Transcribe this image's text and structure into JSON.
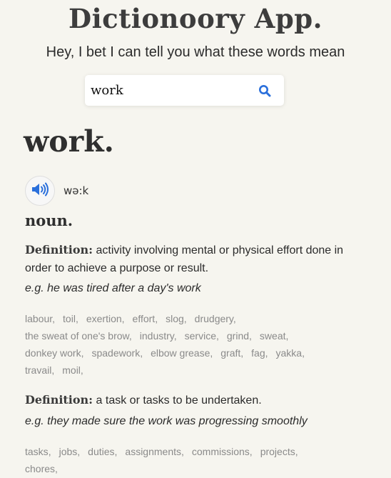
{
  "header": {
    "title": "Dictionoory App.",
    "subtitle": "Hey, I bet I can tell you what these words mean"
  },
  "search": {
    "value": "work",
    "icon": "search-icon"
  },
  "entry": {
    "word": "work.",
    "phonetic": "wə:k",
    "audio_icon": "speaker-icon",
    "part_of_speech": "noun.",
    "definitions": [
      {
        "label": "Definition:",
        "text": "activity involving mental or physical effort done in order to achieve a purpose or result.",
        "example": "e.g. he was tired after a day's work",
        "synonyms": [
          "labour",
          "toil",
          "exertion",
          "effort",
          "slog",
          "drudgery",
          "the sweat of one's brow",
          "industry",
          "service",
          "grind",
          "sweat",
          "donkey work",
          "spadework",
          "elbow grease",
          "graft",
          "fag",
          "yakka",
          "travail",
          "moil"
        ]
      },
      {
        "label": "Definition:",
        "text": "a task or tasks to be undertaken.",
        "example": "e.g. they made sure the work was progressing smoothly",
        "synonyms": [
          "tasks",
          "jobs",
          "duties",
          "assignments",
          "commissions",
          "projects",
          "chores"
        ]
      }
    ]
  },
  "colors": {
    "background": "#f6f5ef",
    "accent": "#2a6fdb",
    "synonym": "#8a8a8a"
  }
}
